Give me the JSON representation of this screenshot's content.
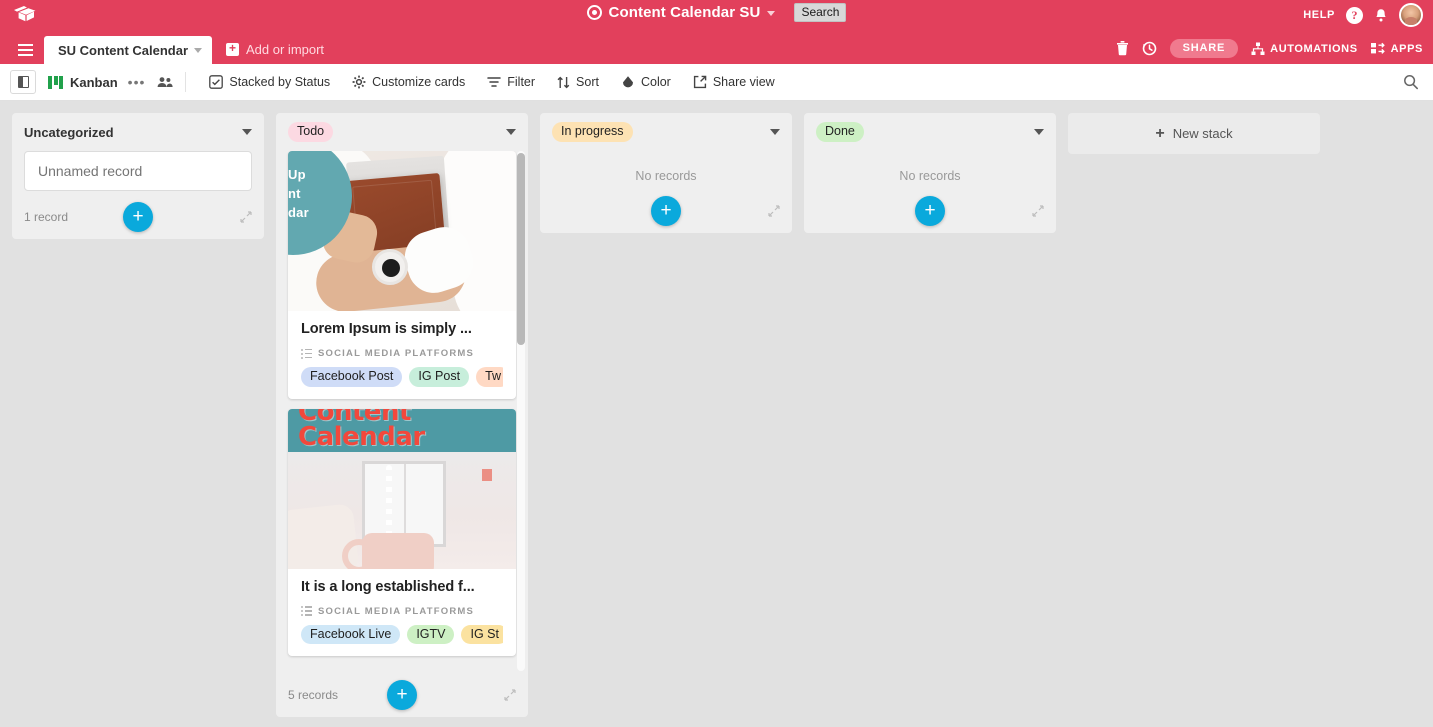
{
  "header": {
    "logo_icon": "airtable-logo-icon",
    "base_icon": "base-target-icon",
    "base_title": "Content Calendar SU",
    "base_caret": "chevron-down-icon",
    "search_tooltip": "Search",
    "help_label": "HELP",
    "help_icon": "question-circle-icon",
    "notifications_icon": "bell-icon",
    "avatar": "user-avatar",
    "hamburger_icon": "hamburger-menu-icon",
    "active_tab": "SU Content Calendar",
    "tab_caret": "chevron-down-icon",
    "add_or_import": "Add or import",
    "trash_icon": "trash-icon",
    "history_icon": "history-clock-icon",
    "share_label": "SHARE",
    "automations_label": "AUTOMATIONS",
    "automations_icon": "automations-icon",
    "apps_label": "APPS",
    "apps_icon": "apps-icon"
  },
  "toolbar": {
    "sidebar_toggle_icon": "sidebar-panel-icon",
    "view_icon": "kanban-view-icon",
    "view_name": "Kanban",
    "more_icon": "ellipsis-icon",
    "collaborators_icon": "collaborators-icon",
    "items": [
      {
        "label": "Stacked by Status",
        "icon": "stacked-by-icon"
      },
      {
        "label": "Customize cards",
        "icon": "gear-icon"
      },
      {
        "label": "Filter",
        "icon": "filter-icon"
      },
      {
        "label": "Sort",
        "icon": "sort-icon"
      },
      {
        "label": "Color",
        "icon": "color-drop-icon"
      },
      {
        "label": "Share view",
        "icon": "share-view-icon"
      }
    ],
    "search_icon": "search-icon"
  },
  "board": {
    "new_stack_label": "New stack",
    "new_stack_plus": "+",
    "add_record_plus": "+",
    "expand_icon": "expand-stack-icon",
    "stack_caret_icon": "chevron-down-icon",
    "stacks": [
      {
        "title": "Uncategorized",
        "chip": false,
        "chip_bg": "",
        "record_count": "1 record",
        "empty_text": "",
        "input_placeholder": "Unnamed record",
        "cards": []
      },
      {
        "title": "Todo",
        "chip": true,
        "chip_bg": "#fcd9e2",
        "record_count": "5 records",
        "empty_text": "",
        "cards": [
          {
            "title": "Lorem Ipsum is simply ...",
            "field_label": "SOCIAL MEDIA PLATFORMS",
            "cover_text": "Up\nnt\ndar",
            "tags": [
              {
                "label": "Facebook Post",
                "bg": "#cfdcf7"
              },
              {
                "label": "IG Post",
                "bg": "#c7eedb"
              },
              {
                "label": "Tw",
                "bg": "#ffd9c4"
              }
            ]
          },
          {
            "title": "It is a long established f...",
            "field_label": "SOCIAL MEDIA PLATFORMS",
            "cover_text": "Content\nCalendar",
            "tags": [
              {
                "label": "Facebook Live",
                "bg": "#cfe7f7"
              },
              {
                "label": "IGTV",
                "bg": "#cdf0c4"
              },
              {
                "label": "IG St",
                "bg": "#fbe2a0"
              }
            ]
          }
        ]
      },
      {
        "title": "In progress",
        "chip": true,
        "chip_bg": "#fde2b3",
        "record_count": "",
        "empty_text": "No records",
        "cards": []
      },
      {
        "title": "Done",
        "chip": true,
        "chip_bg": "#cdf0c4",
        "record_count": "",
        "empty_text": "No records",
        "cards": []
      }
    ]
  },
  "colors": {
    "brand_red": "#e2405c",
    "accent_blue": "#0aa9dc",
    "kanban_green": "#21a14b"
  }
}
